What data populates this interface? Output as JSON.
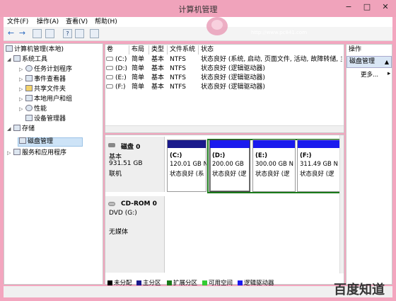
{
  "window": {
    "title": "计算机管理",
    "min": "−",
    "max": "□",
    "close": "✕"
  },
  "menu": [
    {
      "label": "文件(F)"
    },
    {
      "label": "操作(A)"
    },
    {
      "label": "查看(V)"
    },
    {
      "label": "帮助(H)"
    }
  ],
  "watermark": {
    "site": "电脑百事网",
    "url": "http://www.pc841.com",
    "brand": "百度知道"
  },
  "tree": {
    "root": "计算机管理(本地)",
    "system_tools": "系统工具",
    "task_scheduler": "任务计划程序",
    "event_viewer": "事件查看器",
    "shared_folders": "共享文件夹",
    "local_users": "本地用户和组",
    "performance": "性能",
    "device_manager": "设备管理器",
    "storage": "存储",
    "disk_management": "磁盘管理",
    "services_apps": "服务和应用程序"
  },
  "volume_table": {
    "columns": [
      "卷",
      "布局",
      "类型",
      "文件系统",
      "状态"
    ],
    "rows": [
      {
        "vol": "(C:)",
        "layout": "简单",
        "type": "基本",
        "fs": "NTFS",
        "status": "状态良好 (系统, 启动, 页面文件, 活动, 故障转储, 主"
      },
      {
        "vol": "(D:)",
        "layout": "简单",
        "type": "基本",
        "fs": "NTFS",
        "status": "状态良好 (逻辑驱动器)"
      },
      {
        "vol": "(E:)",
        "layout": "简单",
        "type": "基本",
        "fs": "NTFS",
        "status": "状态良好 (逻辑驱动器)"
      },
      {
        "vol": "(F:)",
        "layout": "简单",
        "type": "基本",
        "fs": "NTFS",
        "status": "状态良好 (逻辑驱动器)"
      }
    ]
  },
  "disk0": {
    "name": "磁盘 0",
    "type": "基本",
    "size": "931.51 GB",
    "state": "联机"
  },
  "partitions": [
    {
      "label": "(C:)",
      "size": "120.01 GB N",
      "status": "状态良好 (系"
    },
    {
      "label": "(D:)",
      "size": "200.00 GB",
      "status": "状态良好 (逻"
    },
    {
      "label": "(E:)",
      "size": "300.00 GB N",
      "status": "状态良好 (逻"
    },
    {
      "label": "(F:)",
      "size": "311.49 GB N",
      "status": "状态良好 (逻"
    }
  ],
  "cdrom": {
    "name": "CD-ROM 0",
    "drive": "DVD (G:)",
    "media": "无媒体"
  },
  "legend": [
    {
      "label": "未分配",
      "color": "#000000"
    },
    {
      "label": "主分区",
      "color": "#1a1a8c"
    },
    {
      "label": "扩展分区",
      "color": "#1a7a1a"
    },
    {
      "label": "可用空间",
      "color": "#33cc33"
    },
    {
      "label": "逻辑驱动器",
      "color": "#1a1aee"
    }
  ],
  "actions": {
    "header": "操作",
    "selected": "磁盘管理",
    "more": "更多...",
    "more_arrow": "▸"
  },
  "icons": {
    "back": "←",
    "forward": "→"
  }
}
